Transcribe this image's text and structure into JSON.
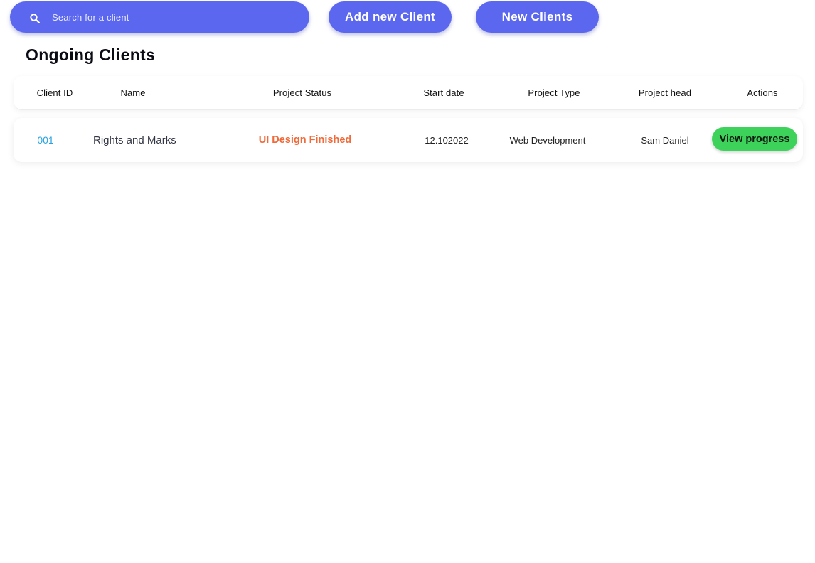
{
  "search": {
    "placeholder": "Search for a client",
    "icon": "search-icon"
  },
  "toolbar": {
    "add_label": "Add new Client",
    "new_label": "New Clients"
  },
  "section": {
    "title": "Ongoing Clients"
  },
  "table": {
    "headers": {
      "client_id": "Client ID",
      "name": "Name",
      "status": "Project Status",
      "start_date": "Start date",
      "type": "Project Type",
      "head": "Project head",
      "actions": "Actions"
    },
    "rows": [
      {
        "client_id": "001",
        "name": "Rights and Marks",
        "status": "UI Design Finished",
        "start_date": "12.102022",
        "type": "Web Development",
        "head": "Sam Daniel",
        "action_label": "View progress"
      }
    ]
  },
  "colors": {
    "accent": "#5b67ee",
    "status_text": "#f06a3a",
    "client_id_text": "#2aa3e0",
    "progress_button": "#3dd35b"
  }
}
